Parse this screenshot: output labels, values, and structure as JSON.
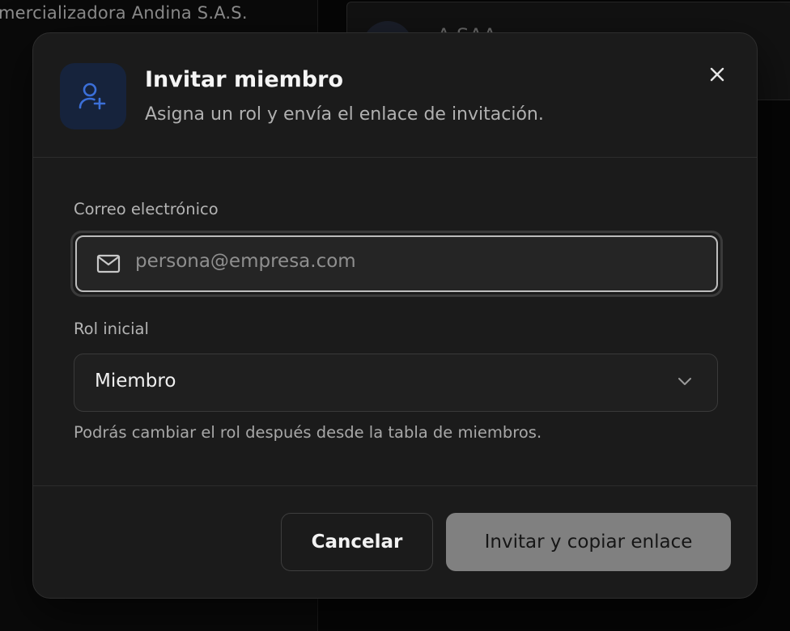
{
  "background": {
    "org_name": "mercializadora Andina S.A.S.",
    "card_title": "A  SAA"
  },
  "modal": {
    "title": "Invitar miembro",
    "subtitle": "Asigna un rol y envía el enlace de invitación.",
    "header_icon": "user-plus-icon",
    "close_icon": "close-icon"
  },
  "form": {
    "email_label": "Correo electrónico",
    "email_placeholder": "persona@empresa.com",
    "email_value": "",
    "email_icon": "mail-icon",
    "role_label": "Rol inicial",
    "role_selected": "Miembro",
    "role_icon": "chevron-down-icon",
    "hint": "Podrás cambiar el rol después desde la tabla de miembros."
  },
  "footer": {
    "cancel_label": "Cancelar",
    "invite_label": "Invitar y copiar enlace"
  },
  "colors": {
    "accent_icon": "#3b6fd8",
    "icon_tile_bg": "#16233c",
    "modal_bg": "#1b1b1b",
    "primary_button_disabled": "#808080"
  }
}
